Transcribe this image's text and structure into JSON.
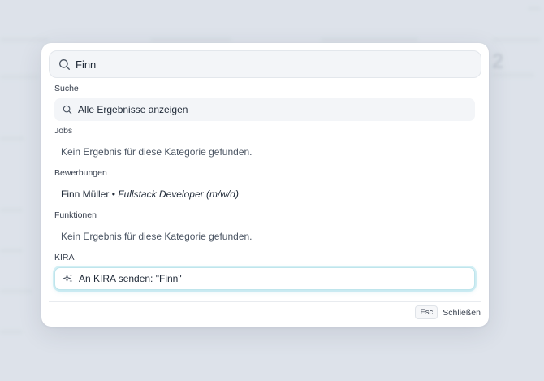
{
  "search": {
    "value": "Finn",
    "icon": "search-icon"
  },
  "sections": {
    "suche": {
      "label": "Suche",
      "item": "Alle Ergebnisse anzeigen"
    },
    "jobs": {
      "label": "Jobs",
      "empty": "Kein Ergebnis für diese Kategorie gefunden."
    },
    "bewerbungen": {
      "label": "Bewerbungen",
      "name": "Finn Müller",
      "separator": " • ",
      "role": "Fullstack Developer (m/w/d)"
    },
    "funktionen": {
      "label": "Funktionen",
      "empty": "Kein Ergebnis für diese Kategorie gefunden."
    },
    "kira": {
      "label": "KIRA",
      "item": "An KIRA senden: \"Finn\"",
      "icon": "sparkle-icon"
    }
  },
  "footer": {
    "key": "Esc",
    "label": "Schließen"
  },
  "background": {
    "number": "2"
  },
  "colors": {
    "accent_border": "#bfe5ec",
    "panel": "#ffffff",
    "backdrop": "#dde3ea"
  }
}
